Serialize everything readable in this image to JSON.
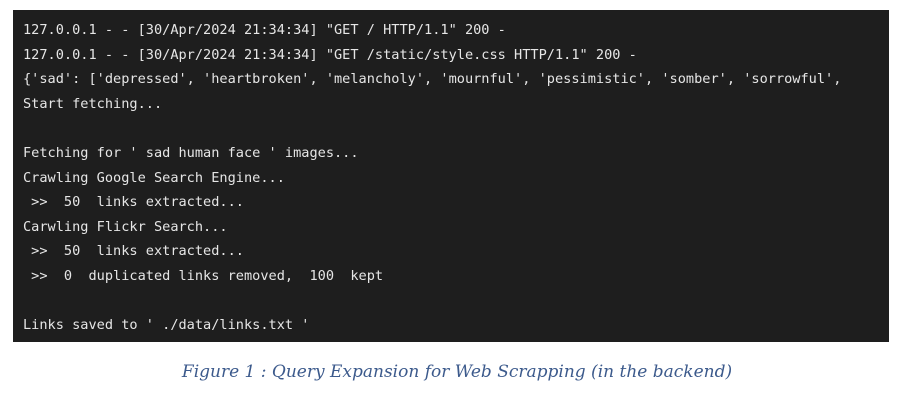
{
  "terminal": {
    "lines": [
      "127.0.0.1 - - [30/Apr/2024 21:34:34] \"GET / HTTP/1.1\" 200 -",
      "127.0.0.1 - - [30/Apr/2024 21:34:34] \"GET /static/style.css HTTP/1.1\" 200 -",
      "{'sad': ['depressed', 'heartbroken', 'melancholy', 'mournful', 'pessimistic', 'somber', 'sorrowful',",
      "Start fetching...",
      "",
      "Fetching for ' sad human face ' images...",
      "Crawling Google Search Engine...",
      " >>  50  links extracted...",
      "Carwling Flickr Search...",
      " >>  50  links extracted...",
      " >>  0  duplicated links removed,  100  kept",
      "",
      "Links saved to ' ./data/links.txt '"
    ]
  },
  "caption": "Figure 1 : Query Expansion for Web Scrapping (in the backend)",
  "colors": {
    "terminal_bg": "#1e1e1e",
    "terminal_text": "#e6e6e6",
    "caption_text": "#3c5a8c"
  }
}
